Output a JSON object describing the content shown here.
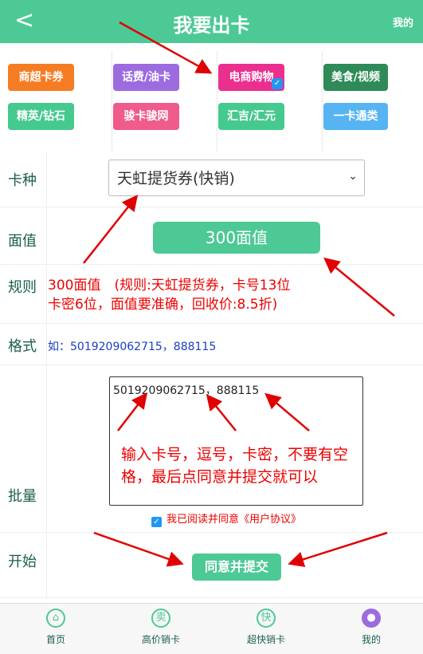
{
  "header": {
    "back_icon": "back-chevron-icon",
    "title": "我要出卡",
    "right_label": "我的"
  },
  "categories": [
    {
      "label": "商超卡券",
      "color": "#f57c23"
    },
    {
      "label": "话费/油卡",
      "color": "#9c6be0"
    },
    {
      "label": "电商购物",
      "color": "#ea2f8f",
      "selected": true
    },
    {
      "label": "美食/视频",
      "color": "#2e8b57"
    },
    {
      "label": "精英/钻石",
      "color": "#45c98e"
    },
    {
      "label": "骏卡骏网",
      "color": "#ef5b8a"
    },
    {
      "label": "汇吉/汇元",
      "color": "#45c98e"
    },
    {
      "label": "一卡通类",
      "color": "#56b4f2"
    }
  ],
  "form": {
    "card_type_label": "卡种",
    "card_type_value": "天虹提货券(快销)",
    "face_label": "面值",
    "face_value": "300面值",
    "rule_label": "规则",
    "rule_line1": "300面值　(规则:天虹提货券，卡号13位",
    "rule_line2": "卡密6位，面值要准确，回收价:8.5折)",
    "format_label": "格式",
    "format_value": "如：5019209062715，888115",
    "batch_label": "批量",
    "batch_value": "5019209062715，888115",
    "agree_text": "我已阅读并同意《用户协议》",
    "start_label": "开始",
    "submit_label": "同意并提交"
  },
  "annotation": {
    "text": "输入卡号，逗号，卡密，不要有空格，最后点同意并提交就可以"
  },
  "tabbar": [
    {
      "icon": "home-icon",
      "glyph": "⌂",
      "label": "首页"
    },
    {
      "icon": "sell-icon",
      "glyph": "卖",
      "label": "高价销卡"
    },
    {
      "icon": "fast-icon",
      "glyph": "快",
      "label": "超快销卡"
    },
    {
      "icon": "user-icon",
      "glyph": "●",
      "label": "我的"
    }
  ],
  "colors": {
    "accent": "#4dc995",
    "annotation_red": "#e00000"
  }
}
